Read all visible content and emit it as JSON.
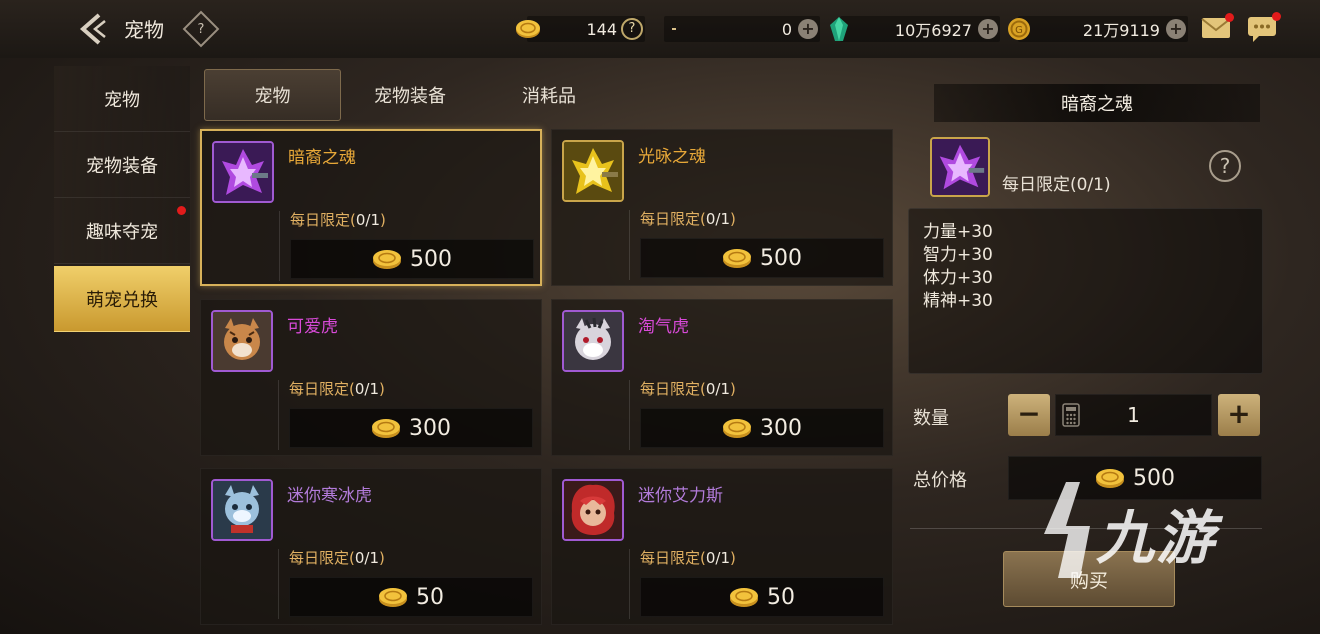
{
  "header": {
    "title": "宠物",
    "help": "?"
  },
  "currencies": [
    {
      "name": "gold-coin",
      "value": "144",
      "action": "help"
    },
    {
      "name": "crescent",
      "value": "0",
      "action": "add"
    },
    {
      "name": "green-crystal",
      "value": "10万6927",
      "action": "add"
    },
    {
      "name": "gold-medal",
      "value": "21万9119",
      "action": "add"
    }
  ],
  "leftnav": {
    "items": [
      {
        "label": "宠物"
      },
      {
        "label": "宠物装备"
      },
      {
        "label": "趣味夺宠"
      },
      {
        "label": "萌宠兑换"
      }
    ]
  },
  "tabs": [
    {
      "label": "宠物"
    },
    {
      "label": "宠物装备"
    },
    {
      "label": "消耗品"
    }
  ],
  "items": [
    {
      "name": "暗裔之魂",
      "name_color": "#e8a838",
      "limit_prefix": "每日限定(",
      "limit_count": "0/1",
      "limit_suffix": ")",
      "price": "500",
      "thumb": "dark-soul"
    },
    {
      "name": "光咏之魂",
      "name_color": "#e8a838",
      "limit_prefix": "每日限定(",
      "limit_count": "0/1",
      "limit_suffix": ")",
      "price": "500",
      "thumb": "light-soul"
    },
    {
      "name": "可爱虎",
      "name_color": "#d84ad8",
      "limit_prefix": "每日限定(",
      "limit_count": "0/1",
      "limit_suffix": ")",
      "price": "300",
      "thumb": "cute-tiger"
    },
    {
      "name": "淘气虎",
      "name_color": "#d84ad8",
      "limit_prefix": "每日限定(",
      "limit_count": "0/1",
      "limit_suffix": ")",
      "price": "300",
      "thumb": "naughty-tiger"
    },
    {
      "name": "迷你寒冰虎",
      "name_color": "#b27bd9",
      "limit_prefix": "每日限定(",
      "limit_count": "0/1",
      "limit_suffix": ")",
      "price": "50",
      "thumb": "ice-tiger"
    },
    {
      "name": "迷你艾力斯",
      "name_color": "#b27bd9",
      "limit_prefix": "每日限定(",
      "limit_count": "0/1",
      "limit_suffix": ")",
      "price": "50",
      "thumb": "ailisi"
    }
  ],
  "detail": {
    "title": "暗裔之魂",
    "limit": "每日限定(0/1)",
    "help": "?",
    "stats": [
      "力量+30",
      "智力+30",
      "体力+30",
      "精神+30"
    ],
    "qty_label": "数量",
    "qty_minus": "−",
    "qty_plus": "+",
    "qty_value": "1",
    "total_label": "总价格",
    "total_value": "500",
    "buy_label": "购买"
  },
  "watermark": {
    "text": "九游"
  },
  "colors": {
    "accent_gold": "#d7b15a",
    "active_nav": "#e5bf55",
    "limit_orange": "#e0b062",
    "badge_red": "#e11b1b"
  }
}
